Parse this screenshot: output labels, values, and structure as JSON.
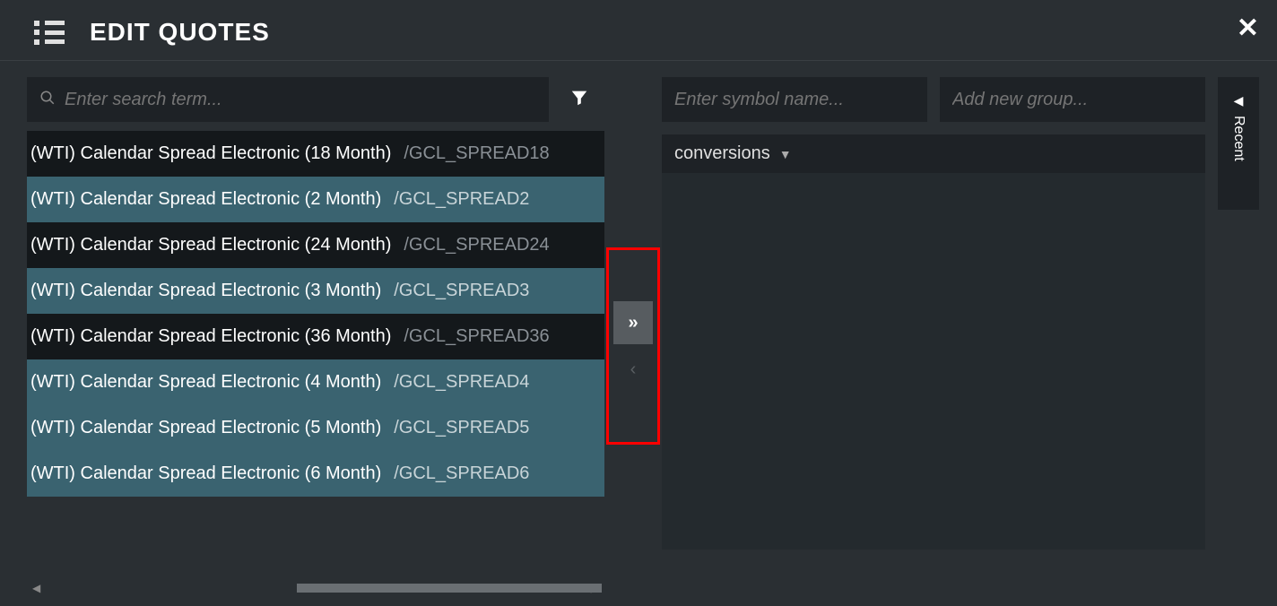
{
  "header": {
    "title": "EDIT QUOTES"
  },
  "search": {
    "placeholder": "Enter search term..."
  },
  "list": {
    "items": [
      {
        "name": "(WTI) Calendar Spread Electronic (18 Month)",
        "code": "/GCL_SPREAD18",
        "selected": false
      },
      {
        "name": "(WTI) Calendar Spread Electronic (2 Month)",
        "code": "/GCL_SPREAD2",
        "selected": true
      },
      {
        "name": "(WTI) Calendar Spread Electronic (24 Month)",
        "code": "/GCL_SPREAD24",
        "selected": false
      },
      {
        "name": "(WTI) Calendar Spread Electronic (3 Month)",
        "code": "/GCL_SPREAD3",
        "selected": true
      },
      {
        "name": "(WTI) Calendar Spread Electronic (36 Month)",
        "code": "/GCL_SPREAD36",
        "selected": false
      },
      {
        "name": "(WTI) Calendar Spread Electronic (4 Month)",
        "code": "/GCL_SPREAD4",
        "selected": true
      },
      {
        "name": "(WTI) Calendar Spread Electronic (5 Month)",
        "code": "/GCL_SPREAD5",
        "selected": true
      },
      {
        "name": "(WTI) Calendar Spread Electronic (6 Month)",
        "code": "/GCL_SPREAD6",
        "selected": true
      }
    ]
  },
  "right": {
    "symbol_placeholder": "Enter symbol name...",
    "group_placeholder": "Add new group...",
    "group_name": "conversions"
  },
  "recent": {
    "label": "Recent"
  }
}
